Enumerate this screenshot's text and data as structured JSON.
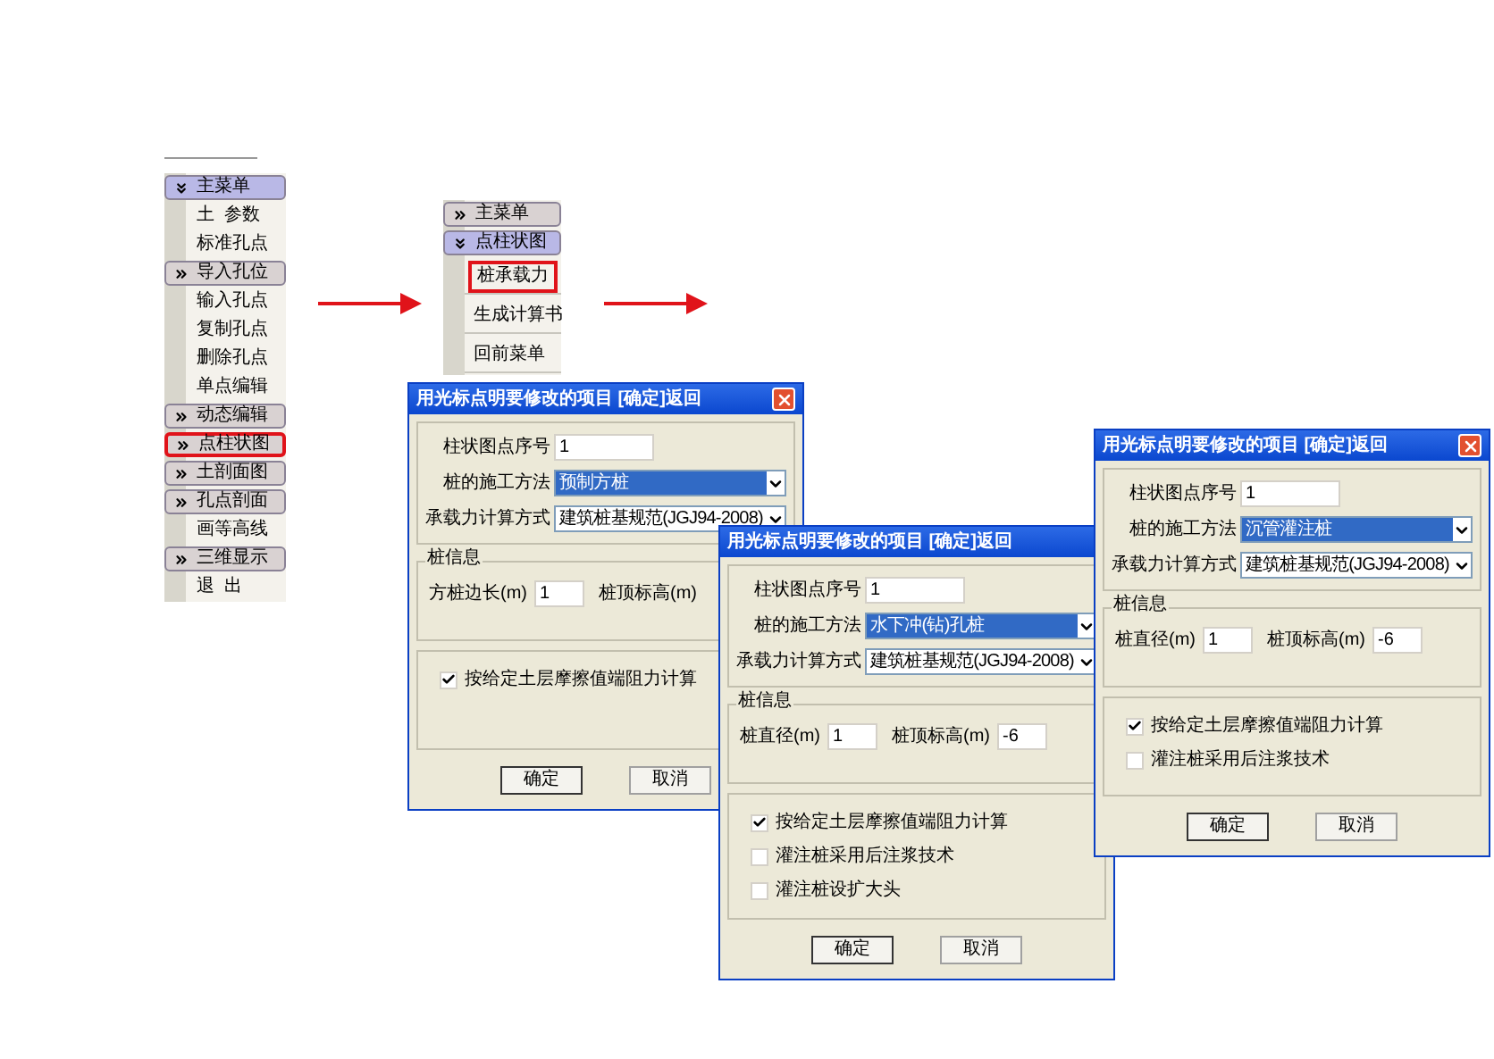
{
  "menus": [
    {
      "rows": [
        {
          "kind": "header",
          "label": "主菜单",
          "expanded": true,
          "highlighted": false
        },
        {
          "kind": "item",
          "label": "土  参数",
          "highlighted": false
        },
        {
          "kind": "item",
          "label": "标准孔点",
          "highlighted": false
        },
        {
          "kind": "header",
          "label": "导入孔位",
          "expanded": false,
          "highlighted": false
        },
        {
          "kind": "item",
          "label": "输入孔点",
          "highlighted": false
        },
        {
          "kind": "item",
          "label": "复制孔点",
          "highlighted": false
        },
        {
          "kind": "item",
          "label": "删除孔点",
          "highlighted": false
        },
        {
          "kind": "item",
          "label": "单点编辑",
          "highlighted": false
        },
        {
          "kind": "header",
          "label": "动态编辑",
          "expanded": false,
          "highlighted": false
        },
        {
          "kind": "header",
          "label": "点柱状图",
          "expanded": false,
          "highlighted": true
        },
        {
          "kind": "header",
          "label": "土剖面图",
          "expanded": false,
          "highlighted": false
        },
        {
          "kind": "header",
          "label": "孔点剖面",
          "expanded": false,
          "highlighted": false
        },
        {
          "kind": "item",
          "label": "画等高线",
          "highlighted": false
        },
        {
          "kind": "header",
          "label": "三维显示",
          "expanded": false,
          "highlighted": false
        },
        {
          "kind": "item",
          "label": "退  出",
          "highlighted": false
        }
      ]
    },
    {
      "rows": [
        {
          "kind": "header",
          "label": "主菜单",
          "expanded": false,
          "highlighted": false
        },
        {
          "kind": "header",
          "label": "点柱状图",
          "expanded": true,
          "highlighted": false
        },
        {
          "kind": "item",
          "label": "桩承载力",
          "highlighted": true
        },
        {
          "kind": "item",
          "label": "生成计算书",
          "highlighted": false
        },
        {
          "kind": "item",
          "label": "回前菜单",
          "highlighted": false
        }
      ]
    }
  ],
  "dialogs": [
    {
      "title": "用光标点明要修改的项目 [确定]返回",
      "close_button": true,
      "fields": [
        {
          "kind": "text",
          "label": "柱状图点序号",
          "value": "1"
        },
        {
          "kind": "select",
          "label": "桩的施工方法",
          "value": "预制方桩",
          "selected": true
        },
        {
          "kind": "select",
          "label": "承载力计算方式",
          "value": "建筑桩基规范(JGJ94-2008)",
          "selected": false
        }
      ],
      "pile_info": {
        "title": "桩信息",
        "fields": [
          {
            "label": "方桩边长(m)",
            "value": "1"
          },
          {
            "label": "桩顶标高(m)"
          }
        ]
      },
      "options": [
        {
          "label": "按给定土层摩擦值端阻力计算",
          "checked": true
        }
      ],
      "buttons": [
        "确定",
        "取消"
      ]
    },
    {
      "title": "用光标点明要修改的项目 [确定]返回",
      "close_button": false,
      "fields": [
        {
          "kind": "text",
          "label": "柱状图点序号",
          "value": "1"
        },
        {
          "kind": "select",
          "label": "桩的施工方法",
          "value": "水下冲(钻)孔桩",
          "selected": true
        },
        {
          "kind": "select",
          "label": "承载力计算方式",
          "value": "建筑桩基规范(JGJ94-2008)",
          "selected": false
        }
      ],
      "pile_info": {
        "title": "桩信息",
        "fields": [
          {
            "label": "桩直径(m)",
            "value": "1"
          },
          {
            "label": "桩顶标高(m)",
            "value": "-6"
          }
        ]
      },
      "options": [
        {
          "label": "按给定土层摩擦值端阻力计算",
          "checked": true
        },
        {
          "label": "灌注桩采用后注浆技术",
          "checked": false
        },
        {
          "label": "灌注桩设扩大头",
          "checked": false
        }
      ],
      "buttons": [
        "确定",
        "取消"
      ]
    },
    {
      "title": "用光标点明要修改的项目 [确定]返回",
      "close_button": true,
      "fields": [
        {
          "kind": "text",
          "label": "柱状图点序号",
          "value": "1"
        },
        {
          "kind": "select",
          "label": "桩的施工方法",
          "value": "沉管灌注桩",
          "selected": true
        },
        {
          "kind": "select",
          "label": "承载力计算方式",
          "value": "建筑桩基规范(JGJ94-2008)",
          "selected": false
        }
      ],
      "pile_info": {
        "title": "桩信息",
        "fields": [
          {
            "label": "桩直径(m)",
            "value": "1"
          },
          {
            "label": "桩顶标高(m)",
            "value": "-6"
          }
        ]
      },
      "options": [
        {
          "label": "按给定土层摩擦值端阻力计算",
          "checked": true
        },
        {
          "label": "灌注桩采用后注浆技术",
          "checked": false
        }
      ],
      "buttons": [
        "确定",
        "取消"
      ]
    }
  ]
}
